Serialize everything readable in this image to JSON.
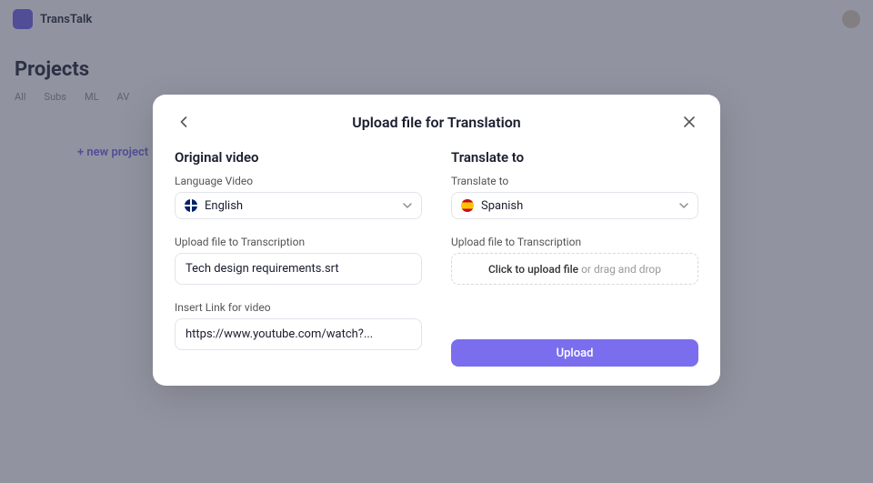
{
  "bg": {
    "brand": "TransTalk",
    "page_title": "Projects",
    "tabs": [
      "All",
      "Subs",
      "ML",
      "AV"
    ],
    "new_project": "+ new project"
  },
  "modal": {
    "title": "Upload file for Translation",
    "left": {
      "heading": "Original video",
      "lang_label": "Language Video",
      "language": "English",
      "upload_label": "Upload file to Transcription",
      "file_name": "Tech design requirements.srt",
      "link_label": "Insert Link for video",
      "link_value": "https://www.youtube.com/watch?..."
    },
    "right": {
      "heading": "Translate to",
      "lang_label": "Translate to",
      "language": "Spanish",
      "upload_label": "Upload file to Transcription",
      "dropzone_main": "Click to upload file",
      "dropzone_sub": "or drag and drop",
      "upload_btn": "Upload"
    }
  }
}
